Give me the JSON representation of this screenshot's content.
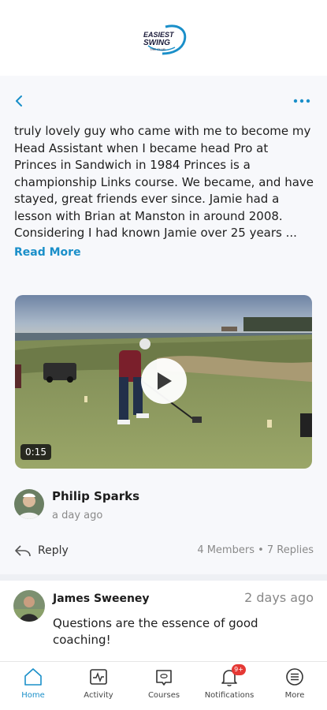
{
  "app": {
    "logo_text_line1": "EASIEST",
    "logo_text_line2": "SWING",
    "logo_text_line3": "THE CLUB",
    "brand_color": "#1a8fc9"
  },
  "topbar": {
    "back_icon": "chevron-left-icon",
    "more_icon": "ellipsis-icon"
  },
  "post": {
    "text": "truly lovely guy who came with me to become my Head Assistant when I became head Pro at Princes in Sandwich in 1984 Princes is a championship Links course. We became, and have stayed, great friends ever since. Jamie had a lesson with Brian at Manston in around 2008. Considering I had known Jamie over 25 years ...",
    "read_more_label": "Read More",
    "video": {
      "duration": "0:15"
    },
    "author": {
      "name": "Philip Sparks",
      "time": "a day ago"
    },
    "reply_label": "Reply",
    "stats": "4 Members • 7 Replies"
  },
  "comment": {
    "author": "James Sweeney",
    "time": "2 days ago",
    "text": "Questions are the essence of good coaching!"
  },
  "tabs": [
    {
      "label": "Home",
      "icon": "home-icon",
      "active": true
    },
    {
      "label": "Activity",
      "icon": "activity-icon"
    },
    {
      "label": "Courses",
      "icon": "courses-icon"
    },
    {
      "label": "Notifications",
      "icon": "bell-icon",
      "badge": "9+"
    },
    {
      "label": "More",
      "icon": "menu-icon"
    }
  ]
}
